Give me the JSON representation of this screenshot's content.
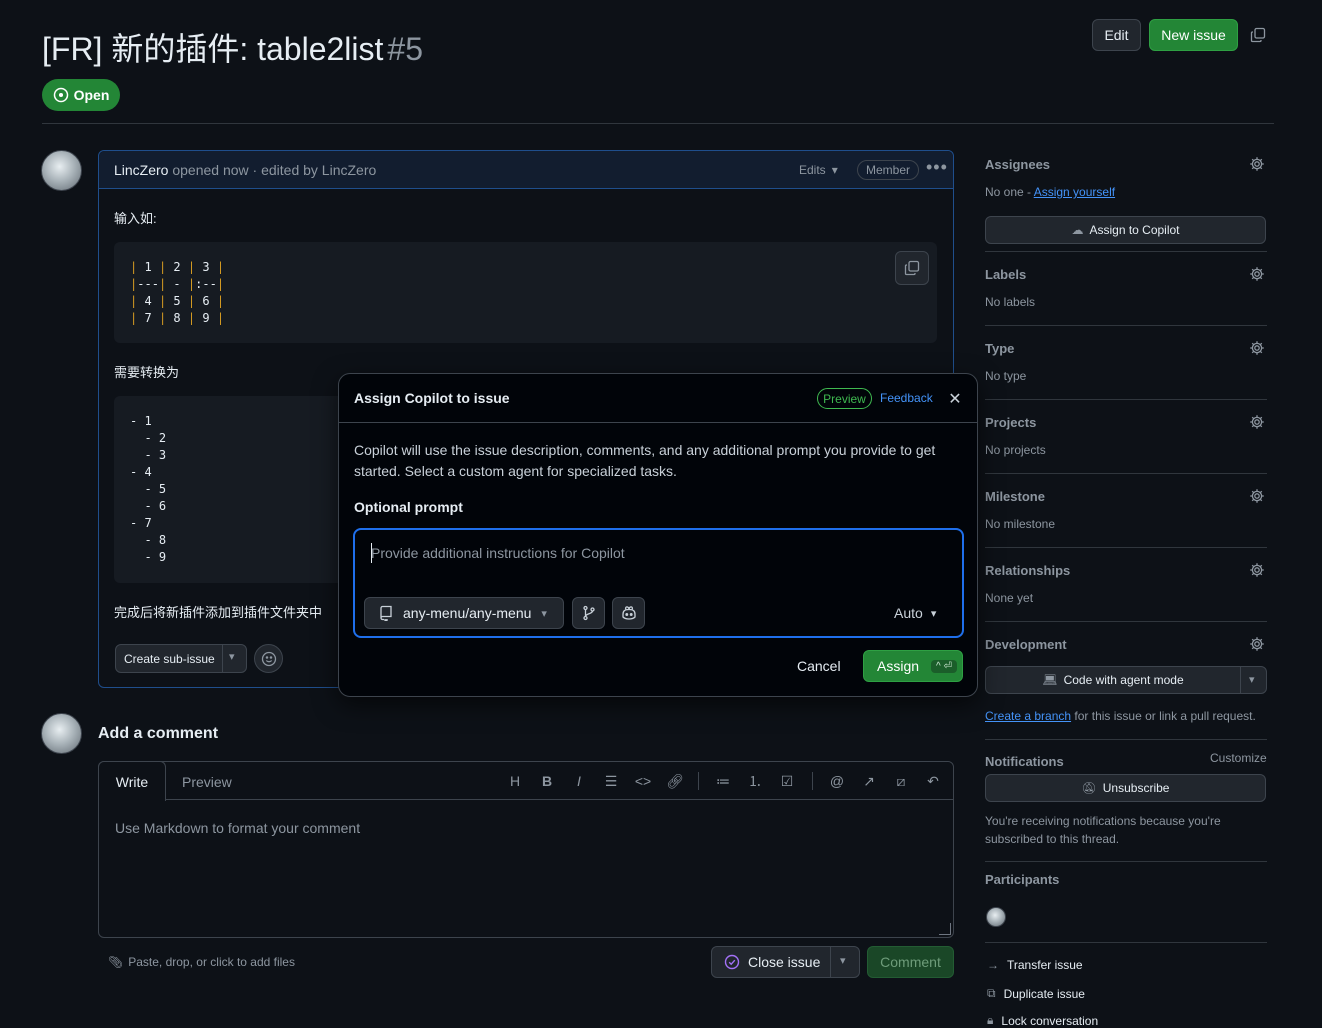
{
  "header": {
    "title": "[FR] 新的插件: table2list",
    "number": "#5",
    "state": "Open",
    "edit_label": "Edit",
    "new_issue_label": "New issue"
  },
  "comment": {
    "author": "LincZero",
    "meta": "opened now · edited by LincZero",
    "edits_label": "Edits",
    "role_badge": "Member",
    "intro_text": "输入如:",
    "table_code": [
      "| 1 | 2 | 3 |",
      "|---| - |:--|",
      "| 4 | 5 | 6 |",
      "| 7 | 8 | 9 |"
    ],
    "convert_text": "需要转换为",
    "list_code": [
      "- 1",
      "  - 2",
      "  - 3",
      "- 4",
      "  - 5",
      "  - 6",
      "- 7",
      "  - 8",
      "  - 9"
    ],
    "outro_text": "完成后将新插件添加到插件文件夹中",
    "create_sub_issue_label": "Create sub-issue"
  },
  "modal": {
    "title": "Assign Copilot to issue",
    "preview_badge": "Preview",
    "feedback_label": "Feedback",
    "description": "Copilot will use the issue description, comments, and any additional prompt you provide to get started. Select a custom agent for specialized tasks.",
    "prompt_label": "Optional prompt",
    "prompt_placeholder": "Provide additional instructions for Copilot",
    "repo_label": "any-menu/any-menu",
    "model_label": "Auto",
    "cancel_label": "Cancel",
    "assign_label": "Assign",
    "assign_shortcut": "^ ⏎"
  },
  "add_comment": {
    "heading": "Add a comment",
    "tab_write": "Write",
    "tab_preview": "Preview",
    "placeholder": "Use Markdown to format your comment",
    "attach_hint": "Paste, drop, or click to add files",
    "close_issue_label": "Close issue",
    "comment_label": "Comment"
  },
  "sidebar": {
    "assignees": {
      "title": "Assignees",
      "value": "No one - ",
      "assign_yourself": "Assign yourself",
      "copilot_button": "Assign to Copilot"
    },
    "labels": {
      "title": "Labels",
      "value": "No labels"
    },
    "type": {
      "title": "Type",
      "value": "No type"
    },
    "projects": {
      "title": "Projects",
      "value": "No projects"
    },
    "milestone": {
      "title": "Milestone",
      "value": "No milestone"
    },
    "relationships": {
      "title": "Relationships",
      "value": "None yet"
    },
    "development": {
      "title": "Development",
      "button": "Code with agent mode",
      "create_branch": "Create a branch",
      "branch_suffix": " for this issue or link a pull request."
    },
    "notifications": {
      "title": "Notifications",
      "customize": "Customize",
      "button": "Unsubscribe",
      "note": "You're receiving notifications because you're subscribed to this thread."
    },
    "participants": {
      "title": "Participants"
    },
    "actions": {
      "transfer": "Transfer issue",
      "duplicate": "Duplicate issue",
      "lock": "Lock conversation"
    }
  }
}
